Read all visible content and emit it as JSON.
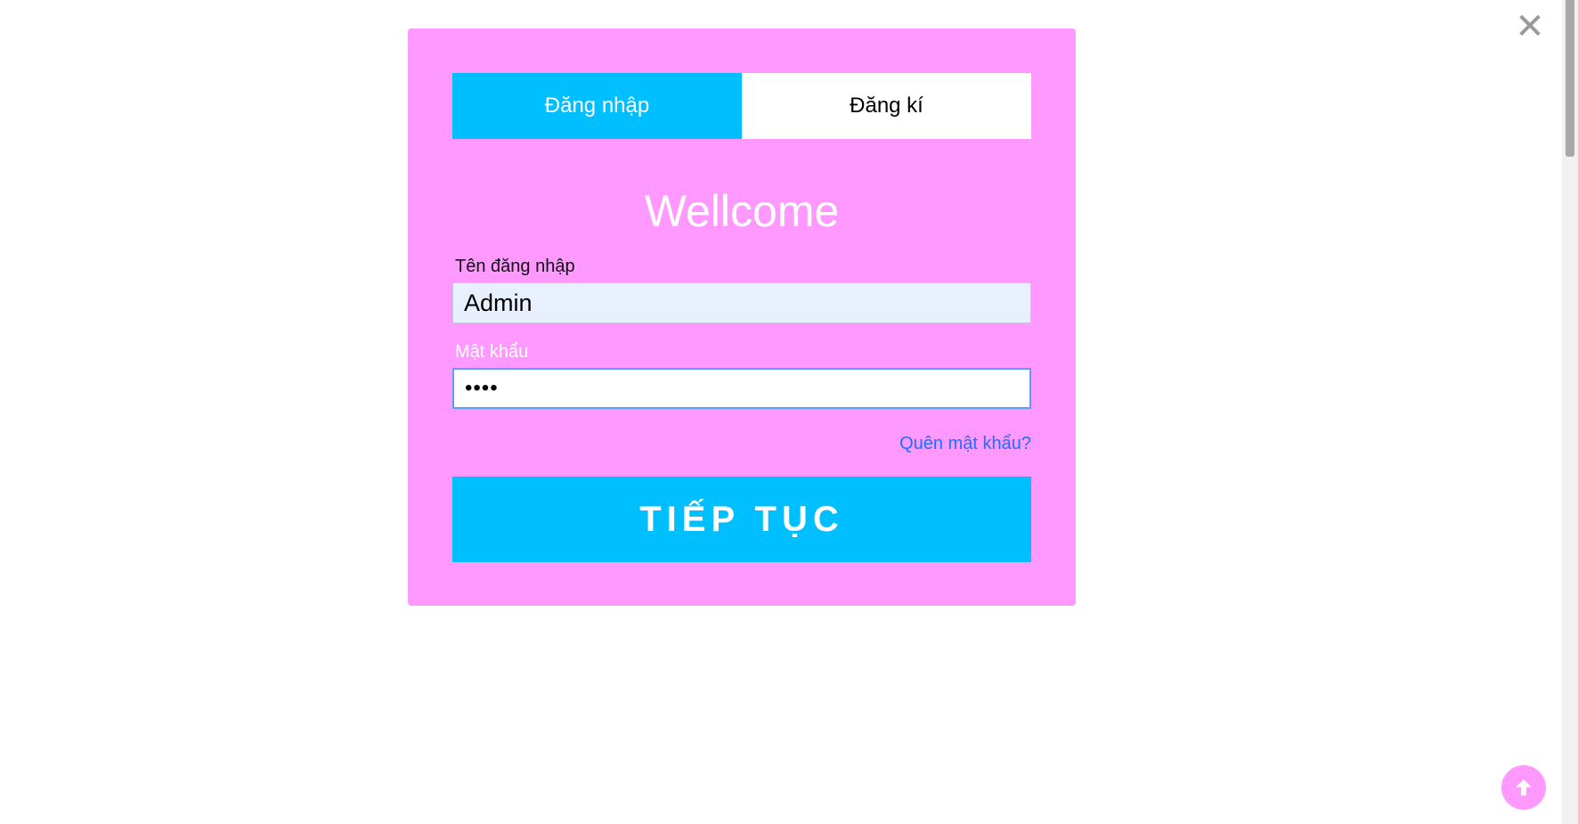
{
  "tabs": {
    "login_label": "Đăng nhập",
    "register_label": "Đăng kí"
  },
  "heading": "Wellcome",
  "form": {
    "username_label": "Tên đăng nhập",
    "username_value": "Admin",
    "password_label": "Mật khẩu",
    "password_value": "••••",
    "forgot_label": "Quên mật khẩu?",
    "submit_label": "TIẾP TỤC"
  },
  "icons": {
    "close": "close-icon",
    "back_to_top": "arrow-up-circle-icon"
  },
  "colors": {
    "modal_bg": "#ff99ff",
    "accent": "#00bfff",
    "link": "#1e6fff",
    "username_bg": "#e8f0fe"
  }
}
